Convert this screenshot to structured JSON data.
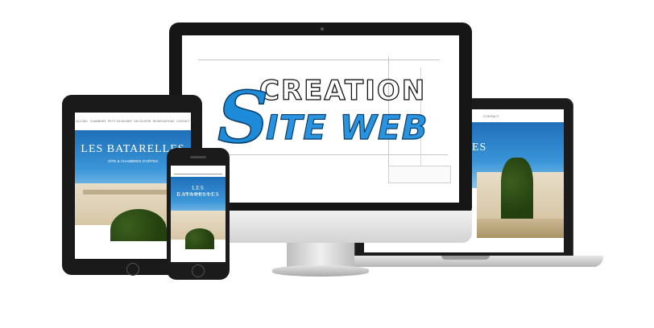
{
  "logo": {
    "line1": "CREATION",
    "big_letter": "S",
    "line2": "ITE WEB"
  },
  "site": {
    "title": "LES BATARELLES",
    "subtitle": "GÎTE & CHAMBRES D'HÔTES",
    "nav": [
      "ACCUEIL",
      "CHAMBRES",
      "PETIT DEJEUNER",
      "DECOUVRIR",
      "RESERVATIONS",
      "CONTACT"
    ],
    "laptop_nav_item": "CONTACT",
    "laptop_title_fragment": "ES"
  },
  "colors": {
    "sky_blue": "#2a80c8",
    "logo_blue": "#2a93e0",
    "device_black": "#1b1b1b",
    "silver": "#d0d0d0"
  }
}
